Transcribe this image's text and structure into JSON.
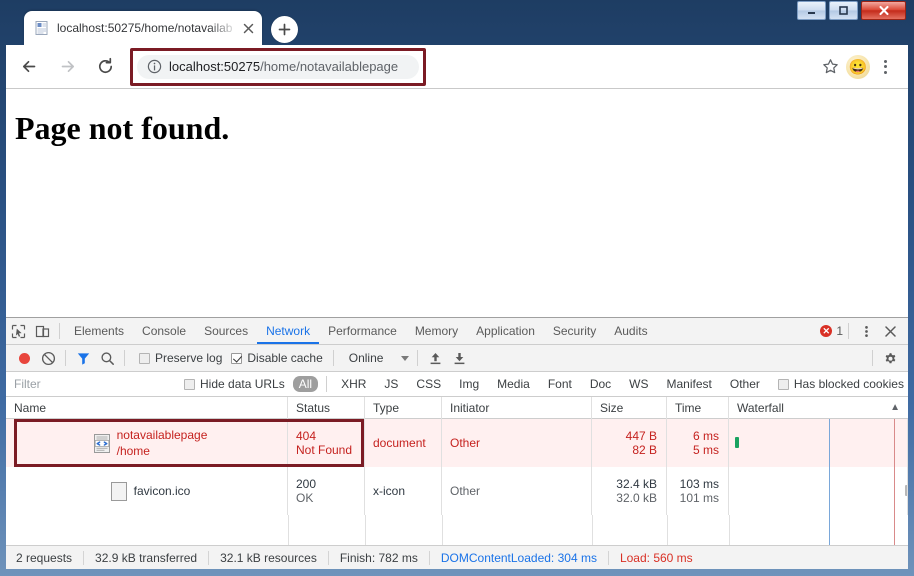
{
  "window": {
    "minimize_label": "Minimize",
    "maximize_label": "Maximize",
    "close_label": "Close"
  },
  "browser": {
    "tab": {
      "title": "localhost:50275/home/notavailab",
      "favicon": "page-favicon",
      "close_label": "×"
    },
    "new_tab_label": "+",
    "nav": {
      "back_label": "←",
      "forward_label": "→",
      "reload_label": "⟳"
    },
    "omnibox": {
      "info_icon": "info-circle-icon",
      "host": "localhost:50275",
      "path": "/home/notavailablepage",
      "full_url": "localhost:50275/home/notavailablepage",
      "highlight_color": "#7b1b24"
    },
    "star_label": "☆",
    "avatar_emoji": "😀",
    "menu_label": "⋮"
  },
  "page": {
    "heading": "Page not found."
  },
  "devtools": {
    "inspect_icon": "inspect-cursor-icon",
    "device_icon": "device-toolbar-icon",
    "tabs": [
      {
        "label": "Elements",
        "active": false
      },
      {
        "label": "Console",
        "active": false
      },
      {
        "label": "Sources",
        "active": false
      },
      {
        "label": "Network",
        "active": true
      },
      {
        "label": "Performance",
        "active": false
      },
      {
        "label": "Memory",
        "active": false
      },
      {
        "label": "Application",
        "active": false
      },
      {
        "label": "Security",
        "active": false
      },
      {
        "label": "Audits",
        "active": false
      }
    ],
    "error_count": "1",
    "error_dot_label": "✕",
    "more_label": "⋮",
    "close_label": "✕",
    "network_toolbar": {
      "record_label": "Record",
      "clear_label": "Clear",
      "filter_label": "Filter",
      "search_label": "Search",
      "preserve_log": "Preserve log",
      "preserve_log_checked": false,
      "disable_cache": "Disable cache",
      "disable_cache_checked": true,
      "throttling": "Online",
      "import_label": "Import HAR",
      "export_label": "Export HAR",
      "settings_label": "Settings"
    },
    "filter_bar": {
      "placeholder": "Filter",
      "value": "",
      "hide_data_urls": "Hide data URLs",
      "hide_data_urls_checked": false,
      "types": [
        "All",
        "XHR",
        "JS",
        "CSS",
        "Img",
        "Media",
        "Font",
        "Doc",
        "WS",
        "Manifest",
        "Other"
      ],
      "active_type": "All",
      "has_blocked_cookies": "Has blocked cookies",
      "has_blocked_cookies_checked": false
    },
    "table": {
      "columns": [
        "Name",
        "Status",
        "Type",
        "Initiator",
        "Size",
        "Time",
        "Waterfall"
      ],
      "sort_indicator": "▲",
      "rows": [
        {
          "name": "notavailablepage",
          "name_sub": "/home",
          "status": "404",
          "status_sub": "Not Found",
          "type": "document",
          "initiator": "Other",
          "size": "447 B",
          "size_sub": "82 B",
          "time": "6 ms",
          "time_sub": "5 ms",
          "error": true,
          "icon": "document-code-icon"
        },
        {
          "name": "favicon.ico",
          "name_sub": "",
          "status": "200",
          "status_sub": "OK",
          "type": "x-icon",
          "initiator": "Other",
          "size": "32.4 kB",
          "size_sub": "32.0 kB",
          "time": "103 ms",
          "time_sub": "101 ms",
          "error": false,
          "icon": "blank-file-icon"
        }
      ],
      "row_highlight_color": "#7b1b24"
    },
    "status_bar": {
      "requests": "2 requests",
      "transferred": "32.9 kB transferred",
      "resources": "32.1 kB resources",
      "finish": "Finish: 782 ms",
      "dom_content_loaded": "DOMContentLoaded: 304 ms",
      "load": "Load: 560 ms",
      "dcl_color": "#1a73e8",
      "load_color": "#d93025"
    }
  }
}
